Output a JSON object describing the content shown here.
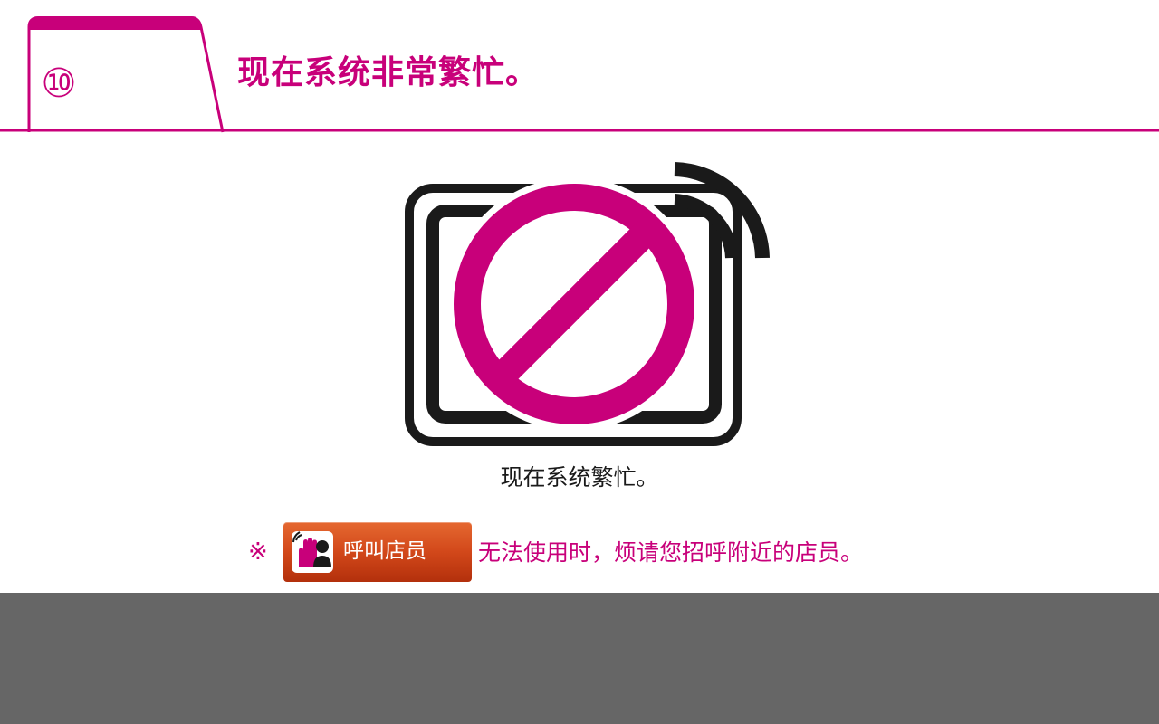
{
  "header": {
    "step_number": "⑩",
    "title": "现在系统非常繁忙。"
  },
  "main": {
    "icon": "busy-camera-prohibited-icon",
    "status_message": "现在系统繁忙。"
  },
  "note": {
    "mark": "※",
    "button_label": "呼叫店员",
    "button_icon": "call-staff-hand-icon",
    "text": "无法使用时，烦请您招呼附近的店员。"
  },
  "colors": {
    "accent": "#c8007a",
    "button": "#d2481a",
    "footer": "#666666",
    "icon_black": "#1a1a1a"
  }
}
